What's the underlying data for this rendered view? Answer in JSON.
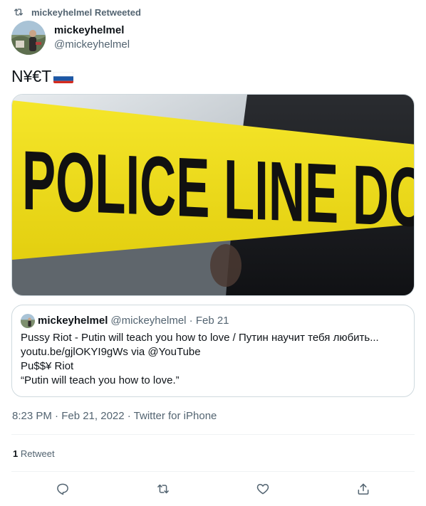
{
  "retweet_header": {
    "text": "mickeyhelmel Retweeted",
    "icon": "retweet-icon"
  },
  "author": {
    "display_name": "mickeyhelmel",
    "handle": "@mickeyhelmel"
  },
  "tweet": {
    "text": "N¥€T",
    "flag": "russia-flag"
  },
  "media": {
    "caption_text": "POLICE LINE DO"
  },
  "quote": {
    "display_name": "mickeyhelmel",
    "handle_date": "@mickeyhelmel · Feb 21",
    "lines": [
      "Pussy Riot - Putin will teach you how to love / Путин научит тебя любить...",
      "youtu.be/gjlOKYI9gWs via @YouTube",
      "Pu$$¥ Riot",
      "“Putin will teach you how to love.”"
    ]
  },
  "timestamp": {
    "time_date": "8:23 PM · Feb 21, 2022 · ",
    "source": "Twitter for iPhone"
  },
  "stats": {
    "retweet_count": "1",
    "retweet_label": "Retweet"
  },
  "actions": [
    "reply-icon",
    "retweet-icon",
    "like-icon",
    "share-icon"
  ],
  "colors": {
    "secondary_text": "#536471",
    "border": "#cfd9de",
    "tape_yellow": "#f2e01c"
  }
}
